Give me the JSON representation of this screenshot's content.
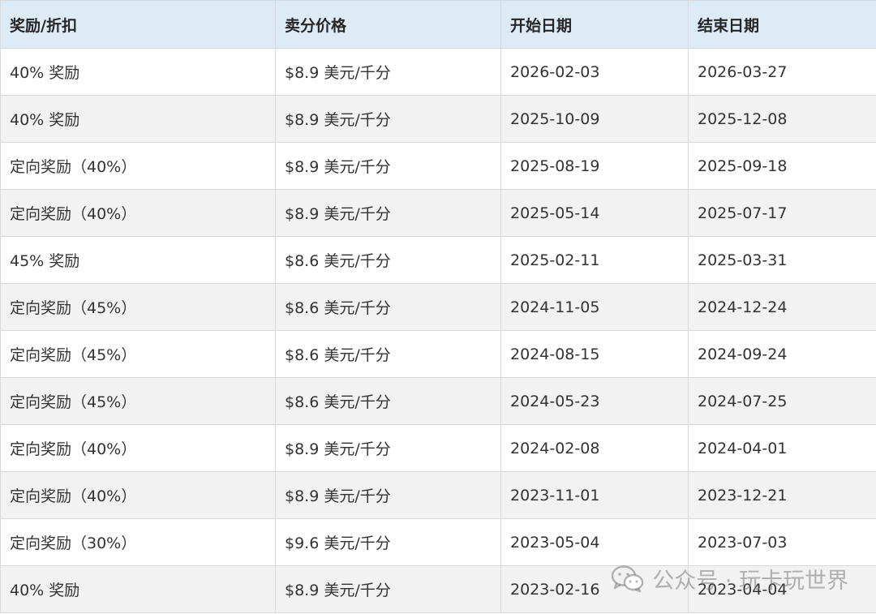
{
  "table": {
    "headers": [
      "奖励/折扣",
      "卖分价格",
      "开始日期",
      "结束日期"
    ],
    "rows": [
      [
        "40% 奖励",
        "$8.9 美元/千分",
        "2026-02-03",
        "2026-03-27"
      ],
      [
        "40% 奖励",
        "$8.9 美元/千分",
        "2025-10-09",
        "2025-12-08"
      ],
      [
        "定向奖励（40%）",
        "$8.9 美元/千分",
        "2025-08-19",
        "2025-09-18"
      ],
      [
        "定向奖励（40%）",
        "$8.9 美元/千分",
        "2025-05-14",
        "2025-07-17"
      ],
      [
        "45% 奖励",
        "$8.6 美元/千分",
        "2025-02-11",
        "2025-03-31"
      ],
      [
        "定向奖励（45%）",
        "$8.6 美元/千分",
        "2024-11-05",
        "2024-12-24"
      ],
      [
        "定向奖励（45%）",
        "$8.6 美元/千分",
        "2024-08-15",
        "2024-09-24"
      ],
      [
        "定向奖励（45%）",
        "$8.6 美元/千分",
        "2024-05-23",
        "2024-07-25"
      ],
      [
        "定向奖励（40%）",
        "$8.9 美元/千分",
        "2024-02-08",
        "2024-04-01"
      ],
      [
        "定向奖励（40%）",
        "$8.9 美元/千分",
        "2023-11-01",
        "2023-12-21"
      ],
      [
        "定向奖励（30%）",
        "$9.6 美元/千分",
        "2023-05-04",
        "2023-07-03"
      ],
      [
        "40% 奖励",
        "$8.9 美元/千分",
        "2023-02-16",
        "2023-04-04"
      ]
    ]
  },
  "watermark": {
    "text": "公众号 · 玩卡玩世界",
    "icon": "wechat-icon"
  },
  "colors": {
    "header_bg": "#ddebf7",
    "row_alt_bg": "#f2f2f2",
    "border": "#d9d9d9",
    "text": "#333333"
  }
}
